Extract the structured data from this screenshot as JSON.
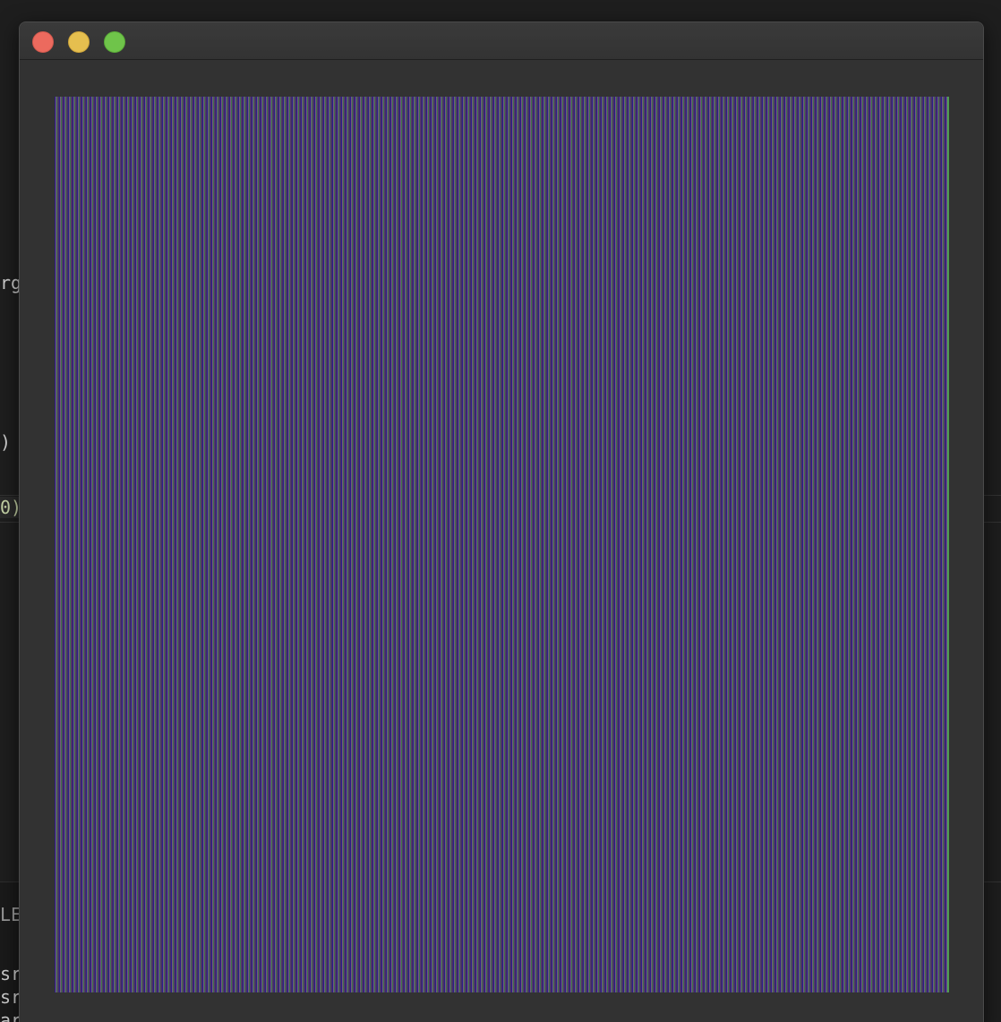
{
  "background_editor": {
    "snippets": [
      {
        "text": "rg"
      },
      {
        "text": ")"
      },
      {
        "text": "0)"
      },
      {
        "text": "LE"
      },
      {
        "text": "sr"
      },
      {
        "text": "sr"
      },
      {
        "text": "ar"
      }
    ]
  },
  "window": {
    "controls": {
      "close": "close",
      "minimize": "minimize",
      "maximize": "maximize"
    },
    "content": {
      "image_description_icon": "striped-image"
    }
  },
  "colors": {
    "close": "#ec6a5e",
    "minimize": "#e5bf4f",
    "maximize": "#6fc44a",
    "window_bg": "#323232",
    "stripe_blue": "#2a1f8f",
    "stripe_green": "#3e7a4e",
    "stripe_purple": "#7a5a86"
  }
}
